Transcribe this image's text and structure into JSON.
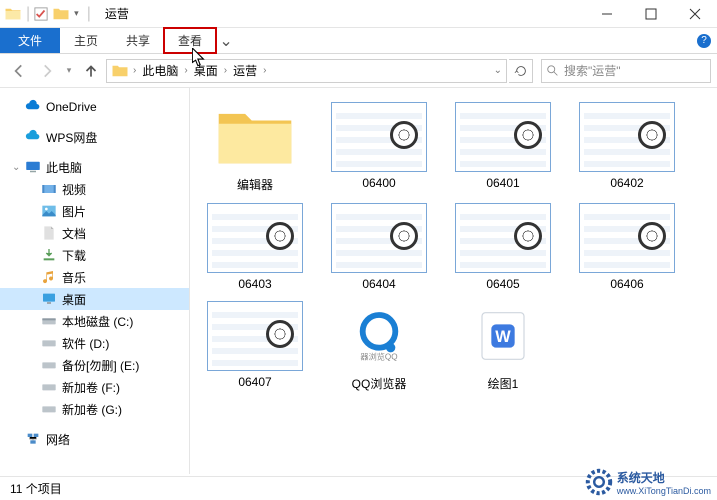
{
  "window": {
    "title": "运营"
  },
  "ribbon": {
    "file": "文件",
    "home": "主页",
    "share": "共享",
    "view": "查看"
  },
  "breadcrumb": {
    "segs": [
      "此电脑",
      "桌面",
      "运营"
    ]
  },
  "search": {
    "placeholder": "搜索\"运营\""
  },
  "sidebar": {
    "onedrive": "OneDrive",
    "wps": "WPS网盘",
    "thispc": "此电脑",
    "video": "视频",
    "pictures": "图片",
    "documents": "文档",
    "downloads": "下载",
    "music": "音乐",
    "desktop": "桌面",
    "cdrive": "本地磁盘 (C:)",
    "ddrive": "软件 (D:)",
    "edrive": "备份[勿删] (E:)",
    "fdrive": "新加卷 (F:)",
    "gdrive": "新加卷 (G:)",
    "network": "网络"
  },
  "items": [
    {
      "name": "编辑器",
      "type": "folder"
    },
    {
      "name": "06400",
      "type": "video"
    },
    {
      "name": "06401",
      "type": "video"
    },
    {
      "name": "06402",
      "type": "video"
    },
    {
      "name": "06403",
      "type": "video"
    },
    {
      "name": "06404",
      "type": "video"
    },
    {
      "name": "06405",
      "type": "video"
    },
    {
      "name": "06406",
      "type": "video"
    },
    {
      "name": "06407",
      "type": "video"
    },
    {
      "name": "QQ浏览器",
      "type": "qq"
    },
    {
      "name": "绘图1",
      "type": "wps"
    }
  ],
  "status": {
    "count": "11 个项目"
  },
  "watermark": {
    "line1": "系统天地",
    "line2": "www.XiTongTianDi.com"
  }
}
